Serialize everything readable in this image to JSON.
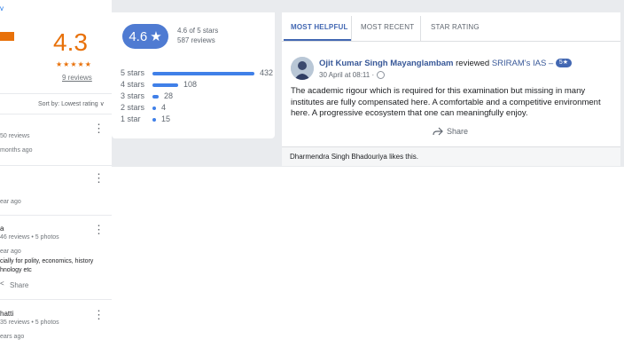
{
  "google": {
    "back_text": "v",
    "rating_value": "4.3",
    "stars": "★★★★★",
    "review_count": "9 reviews",
    "sort_label": "Sort by: Lowest rating ∨",
    "reviews": [
      {
        "name": "",
        "meta": "50 reviews",
        "time": "months ago",
        "text": [],
        "share": ""
      },
      {
        "name": "",
        "meta": "",
        "time": "ear ago",
        "text": [],
        "share": ""
      },
      {
        "name": "a",
        "meta": "46 reviews • 5 photos",
        "time": "ear ago",
        "text": [
          "cially for polity, economics, history",
          "hnology etc"
        ],
        "share": "Share"
      },
      {
        "name": "hatti",
        "meta": "35 reviews • 5 photos",
        "time": "ears ago",
        "text": [],
        "share": ""
      }
    ]
  },
  "summary": {
    "rating": "4.6",
    "star": "★",
    "of_stars": "4.6 of 5 stars",
    "reviews": "587 reviews",
    "distribution": [
      {
        "label": "5 stars",
        "count": 432
      },
      {
        "label": "4 stars",
        "count": 108
      },
      {
        "label": "3 stars",
        "count": 28
      },
      {
        "label": "2 stars",
        "count": 4
      },
      {
        "label": "1 star",
        "count": 15
      }
    ]
  },
  "tabs": [
    "MOST HELPFUL",
    "MOST RECENT",
    "STAR RATING"
  ],
  "post": {
    "author": "Ojit Kumar Singh Mayanglambam",
    "action": "reviewed",
    "page": "SRIRAM's IAS –",
    "badge": "5★",
    "date": "30 April at 08:11 ·",
    "privacy_icon": "globe-icon",
    "text": "The academic rigour which is required for this examination but missing in many institutes are fully compensated here. A comfortable and a competitive environment here. A progressive ecosystem that one can meaningfully enjoy.",
    "share": "Share",
    "likes": "Dharmendra Singh Bhadouriya likes this."
  },
  "colors": {
    "google_orange": "#e8710a",
    "fb_blue": "#4267b2",
    "bar_blue": "#4080e8",
    "grey_bg": "#e9ebee"
  }
}
